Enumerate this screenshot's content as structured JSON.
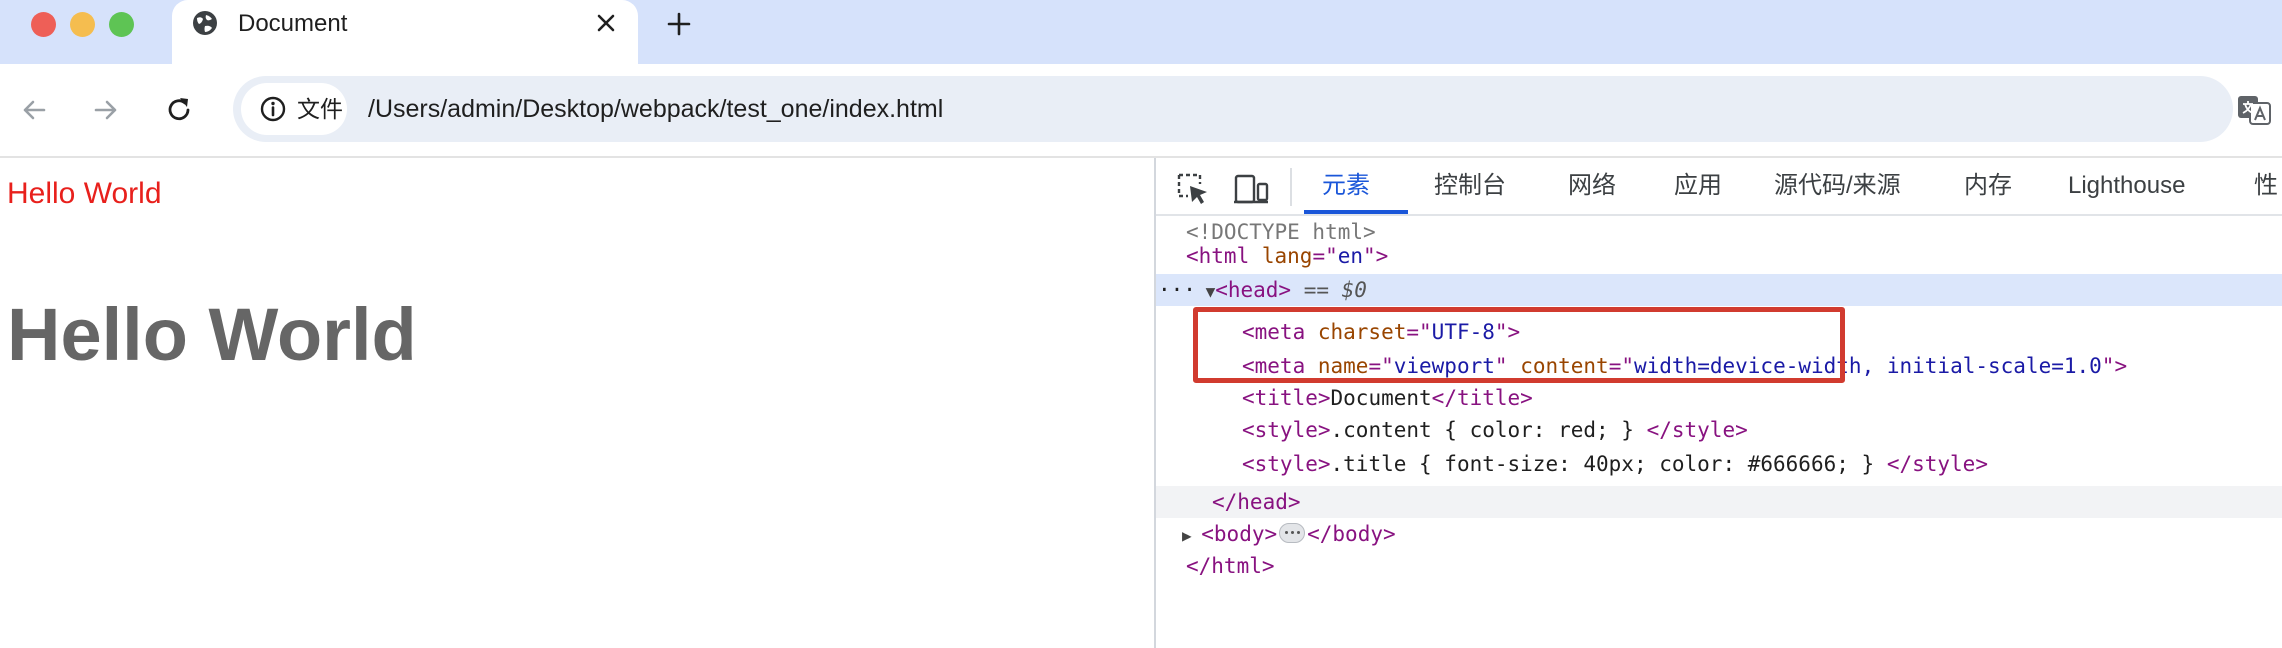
{
  "tab": {
    "title": "Document"
  },
  "toolbar": {
    "site_chip_label": "文件",
    "url": "/Users/admin/Desktop/webpack/test_one/index.html"
  },
  "page": {
    "content_text": "Hello World",
    "title_text": "Hello World",
    "colors": {
      "content": "#e8201c",
      "title": "#666666"
    }
  },
  "devtools": {
    "tabs": [
      {
        "label": "元素",
        "active": true
      },
      {
        "label": "控制台"
      },
      {
        "label": "网络"
      },
      {
        "label": "应用"
      },
      {
        "label": "源代码/来源"
      },
      {
        "label": "内存"
      },
      {
        "label": "Lighthouse"
      },
      {
        "label": "性"
      }
    ],
    "dom": {
      "doctype": "<!DOCTYPE html>",
      "html_open": {
        "tag": "<html",
        "attr": " lang",
        "eq": "=\"",
        "val": "en",
        "end": "\">"
      },
      "head_open": {
        "dots": "···",
        "tag": "<head>",
        "selected": " == $0"
      },
      "meta_charset": {
        "tag": "<meta",
        "attr": " charset",
        "eq": "=\"",
        "val": "UTF-8",
        "end": "\">"
      },
      "meta_viewport": {
        "tag": "<meta",
        "attr1": " name",
        "eq1": "=\"",
        "val1": "viewport",
        "q1": "\"",
        "attr2": " content",
        "eq2": "=\"",
        "val2": "width=device-width, initial-scale=1.0",
        "end": "\">"
      },
      "title": {
        "open": "<title>",
        "text": "Document",
        "close": "</title>"
      },
      "style_content": {
        "open": "<style>",
        "text": ".content { color: red; }",
        "close": " </style>"
      },
      "style_title": {
        "open": "<style>",
        "text": ".title { font-size: 40px; color: #666666; }",
        "close": " </style>"
      },
      "head_close": "</head>",
      "body": {
        "open": "<body>",
        "close": "</body>"
      },
      "html_close": "</html>"
    }
  },
  "colors": {
    "tabstrip_bg": "#d6e2fb",
    "devtools_accent": "#1a56d9",
    "highlight_box": "#d13b2f"
  }
}
